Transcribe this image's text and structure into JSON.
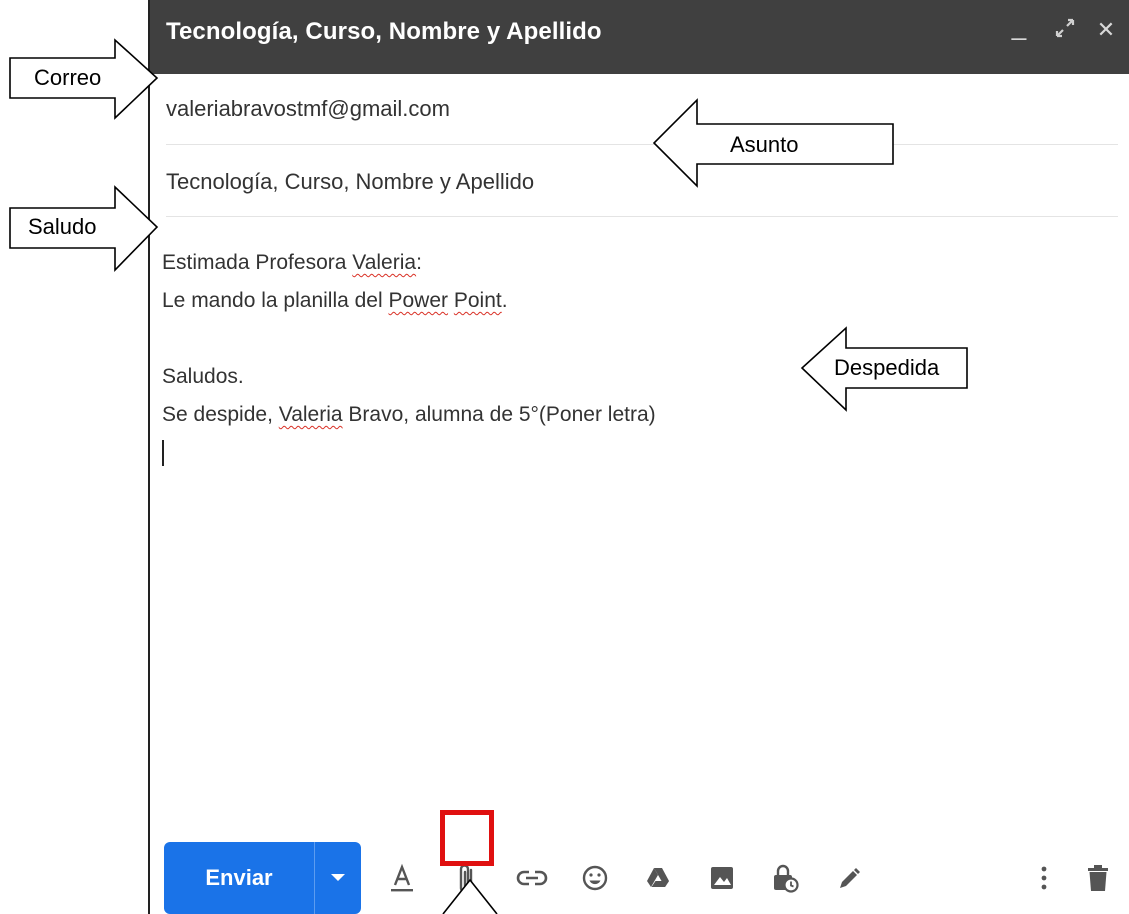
{
  "compose": {
    "title": "Tecnología, Curso, Nombre y Apellido",
    "window_controls": {
      "minimize": "_",
      "expand": "⤢",
      "close": "✕"
    },
    "to": "valeriabravostmf@gmail.com",
    "subject": "Tecnología, Curso, Nombre y Apellido",
    "body": {
      "line1_prefix": "Estimada Profesora ",
      "line1_name": "Valeria",
      "line1_suffix": ":",
      "line2_prefix": "Le mando la planilla del ",
      "line2_power": "Power",
      "line2_space": " ",
      "line2_point": "Point",
      "line2_suffix": ".",
      "line4": "Saludos.",
      "line5_prefix": "Se despide, ",
      "line5_name": "Valeria",
      "line5_suffix": " Bravo, alumna de 5°(Poner letra)"
    },
    "toolbar": {
      "send_label": "Enviar",
      "icons": [
        "format-text-icon",
        "paperclip-icon",
        "link-icon",
        "emoji-icon",
        "drive-icon",
        "photo-icon",
        "confidential-lock-icon",
        "signature-pen-icon",
        "more-vert-icon",
        "trash-icon"
      ]
    }
  },
  "annotations": {
    "correo": "Correo",
    "asunto": "Asunto",
    "saludo": "Saludo",
    "despedida": "Despedida",
    "highlight_color": "#e01010"
  }
}
